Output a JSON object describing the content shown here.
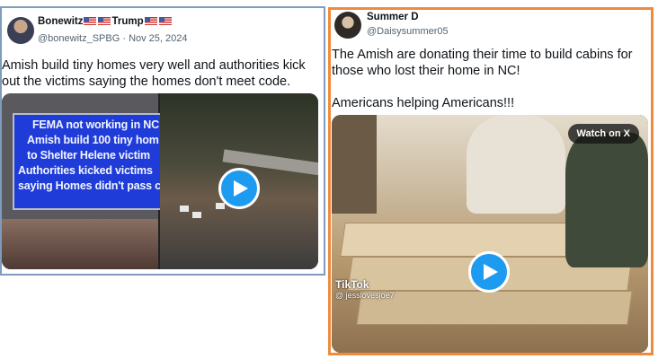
{
  "tweet1": {
    "display_name": "Bonewitz",
    "display_name_suffix": "Trump",
    "handle": "@bonewitz_SPBG",
    "separator": "·",
    "date": "Nov 25, 2024",
    "text": "Amish build tiny homes very well and authorities kick out the victims saying the homes don't meet code.",
    "media": {
      "sign_lines": [
        "FEMA not working in NC",
        "Amish build 100 tiny hom",
        "to Shelter Helene victim",
        "Authorities kicked victims",
        "saying Homes didn't pass co"
      ],
      "icon": "play-icon"
    }
  },
  "tweet2": {
    "display_name": "Summer D",
    "handle": "@Daisysummer05",
    "text_line1": "The Amish are donating their time to build cabins for those who lost their home in NC!",
    "text_line2": "Americans helping Americans!!!",
    "media": {
      "watch_label": "Watch on X",
      "tiktok_label": "TikTok",
      "tiktok_handle": "@ jesslovesjoe7",
      "icon": "play-icon"
    }
  },
  "colors": {
    "tweet1_border": "#7f9bbd",
    "tweet2_border": "#f08a3c",
    "play_button": "#1d9bf0",
    "sign_screen": "#1f3bd8"
  }
}
